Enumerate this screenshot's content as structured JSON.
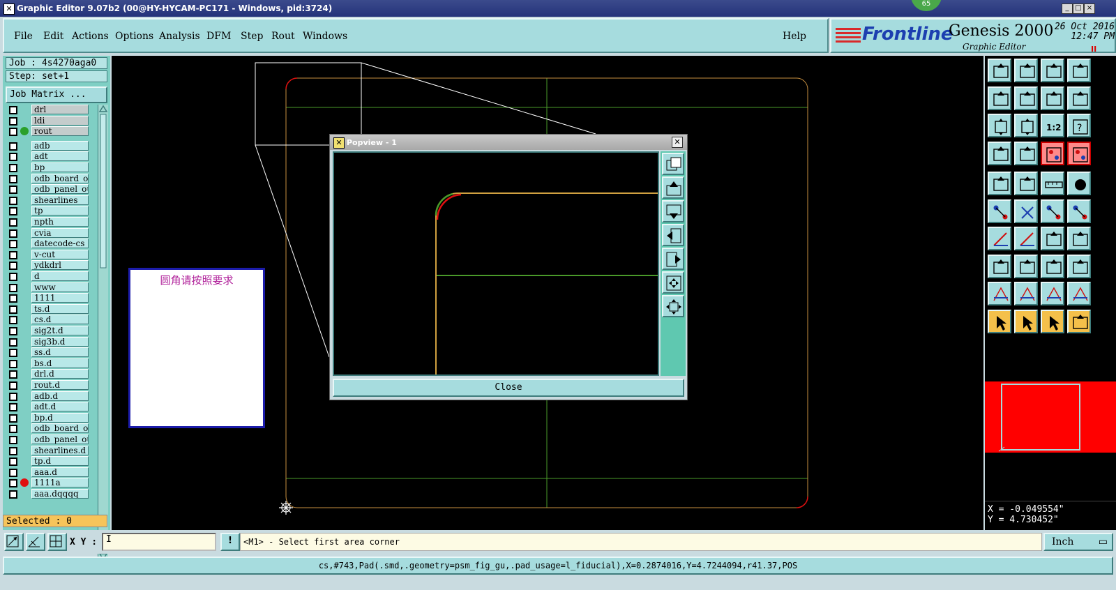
{
  "window": {
    "title": "Graphic Editor 9.07b2 (00@HY-HYCAM-PC171 - Windows, pid:3724)",
    "badge": "65",
    "minimize": "_",
    "maximize": "□",
    "close": "×"
  },
  "menu": {
    "items": [
      "File",
      "Edit",
      "Actions",
      "Options",
      "Analysis",
      "DFM",
      "Step",
      "Rout",
      "Windows"
    ],
    "help": "Help"
  },
  "brand": {
    "logo": "Frontline",
    "product": "Genesis 2000",
    "subtitle": "Graphic Editor",
    "date": "26 Oct 2016",
    "time": "12:47 PM",
    "pause": "II"
  },
  "left": {
    "job": "Job : 4s4270aga0",
    "step": "Step: set+1",
    "job_matrix": "Job Matrix ...",
    "selected": "Selected : 0",
    "layers": [
      {
        "name": "drl",
        "style": "grey",
        "dot": ""
      },
      {
        "name": "ldi",
        "style": "grey",
        "dot": ""
      },
      {
        "name": "rout",
        "style": "grey",
        "dot": "#2aa02a"
      },
      {
        "name": "adb",
        "style": "",
        "dot": ""
      },
      {
        "name": "adt",
        "style": "",
        "dot": ""
      },
      {
        "name": "bp",
        "style": "",
        "dot": ""
      },
      {
        "name": "odb_board_ou",
        "style": "",
        "dot": ""
      },
      {
        "name": "odb_panel_ou",
        "style": "",
        "dot": ""
      },
      {
        "name": "shearlines",
        "style": "",
        "dot": ""
      },
      {
        "name": "tp",
        "style": "",
        "dot": ""
      },
      {
        "name": "npth",
        "style": "",
        "dot": ""
      },
      {
        "name": "cvia",
        "style": "",
        "dot": ""
      },
      {
        "name": "datecode-cs",
        "style": "",
        "dot": ""
      },
      {
        "name": "v-cut",
        "style": "",
        "dot": ""
      },
      {
        "name": "ydkdrl",
        "style": "",
        "dot": ""
      },
      {
        "name": "d",
        "style": "",
        "dot": ""
      },
      {
        "name": "www",
        "style": "",
        "dot": ""
      },
      {
        "name": "1111",
        "style": "",
        "dot": ""
      },
      {
        "name": "ts.d",
        "style": "",
        "dot": ""
      },
      {
        "name": "cs.d",
        "style": "",
        "dot": ""
      },
      {
        "name": "sig2t.d",
        "style": "",
        "dot": ""
      },
      {
        "name": "sig3b.d",
        "style": "",
        "dot": ""
      },
      {
        "name": "ss.d",
        "style": "",
        "dot": ""
      },
      {
        "name": "bs.d",
        "style": "",
        "dot": ""
      },
      {
        "name": "drl.d",
        "style": "",
        "dot": ""
      },
      {
        "name": "rout.d",
        "style": "",
        "dot": ""
      },
      {
        "name": "adb.d",
        "style": "",
        "dot": ""
      },
      {
        "name": "adt.d",
        "style": "",
        "dot": ""
      },
      {
        "name": "bp.d",
        "style": "",
        "dot": ""
      },
      {
        "name": "odb_board_ou",
        "style": "",
        "dot": ""
      },
      {
        "name": "odb_panel_ou",
        "style": "",
        "dot": ""
      },
      {
        "name": "shearlines.d",
        "style": "",
        "dot": ""
      },
      {
        "name": "tp.d",
        "style": "",
        "dot": ""
      },
      {
        "name": "aaa.d",
        "style": "",
        "dot": ""
      },
      {
        "name": "1111a",
        "style": "",
        "dot": "#e01010"
      },
      {
        "name": "aaa.dqqqq",
        "style": "",
        "dot": ""
      }
    ]
  },
  "note": {
    "text": "圆角请按照要求"
  },
  "popview": {
    "title": "Popview - 1",
    "close_label": "Close"
  },
  "coords": {
    "x": "X = -0.049554\"",
    "y": "Y = 4.730452\""
  },
  "bottom": {
    "xy_label": "X Y :",
    "xy_value": "I",
    "alert": "!",
    "message": "<M1> - Select first area corner",
    "unit": "Inch",
    "status": "cs,#743,Pad(.smd,.geometry=psm_fig_gu,.pad_usage=l_fiducial),X=0.2874016,Y=4.7244094,r41.37,POS"
  },
  "colors": {
    "panel": "#a6dcde",
    "canvas": "#000000",
    "profile_line": "#d0a040",
    "outline_green": "#4a9a2a",
    "corner_red": "#e01010",
    "selected": "#f6c45a"
  }
}
